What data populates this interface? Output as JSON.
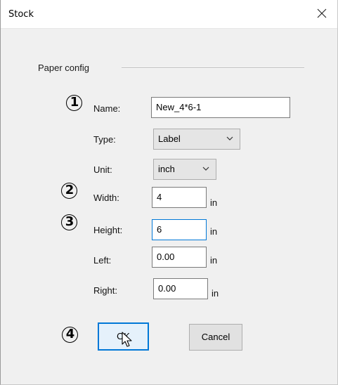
{
  "window": {
    "title": "Stock"
  },
  "group": {
    "label": "Paper config"
  },
  "steps": [
    "1",
    "2",
    "3",
    "4"
  ],
  "fields": {
    "name": {
      "label": "Name:",
      "value": "New_4*6-1"
    },
    "type": {
      "label": "Type:",
      "value": "Label"
    },
    "unit": {
      "label": "Unit:",
      "value": "inch"
    },
    "width": {
      "label": "Width:",
      "value": "4",
      "unit": "in"
    },
    "height": {
      "label": "Height:",
      "value": "6",
      "unit": "in"
    },
    "left": {
      "label": "Left:",
      "value": "0.00",
      "unit": "in"
    },
    "right": {
      "label": "Right:",
      "value": "0.00",
      "unit": "in"
    }
  },
  "buttons": {
    "ok": "OK",
    "cancel": "Cancel"
  },
  "colors": {
    "focus": "#0078d7",
    "dialog_bg": "#f0f0f0"
  },
  "icons": {
    "close": "close-icon",
    "dropdown": "chevron-down-icon",
    "pointer": "mouse-pointer-icon"
  }
}
